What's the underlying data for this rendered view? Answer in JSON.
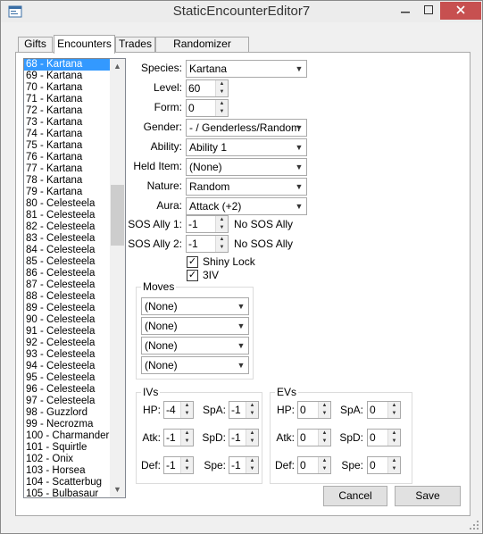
{
  "window": {
    "title": "StaticEncounterEditor7"
  },
  "tabs": [
    {
      "label": "Gifts"
    },
    {
      "label": "Encounters"
    },
    {
      "label": "Trades"
    },
    {
      "label": "Randomizer Options"
    }
  ],
  "encounter_list": {
    "selected_index": 0,
    "items": [
      "68 - Kartana",
      "69 - Kartana",
      "70 - Kartana",
      "71 - Kartana",
      "72 - Kartana",
      "73 - Kartana",
      "74 - Kartana",
      "75 - Kartana",
      "76 - Kartana",
      "77 - Kartana",
      "78 - Kartana",
      "79 - Kartana",
      "80 - Celesteela",
      "81 - Celesteela",
      "82 - Celesteela",
      "83 - Celesteela",
      "84 - Celesteela",
      "85 - Celesteela",
      "86 - Celesteela",
      "87 - Celesteela",
      "88 - Celesteela",
      "89 - Celesteela",
      "90 - Celesteela",
      "91 - Celesteela",
      "92 - Celesteela",
      "93 - Celesteela",
      "94 - Celesteela",
      "95 - Celesteela",
      "96 - Celesteela",
      "97 - Celesteela",
      "98 - Guzzlord",
      "99 - Necrozma",
      "100 - Charmander",
      "101 - Squirtle",
      "102 - Onix",
      "103 - Horsea",
      "104 - Scatterbug",
      "105 - Bulbasaur"
    ]
  },
  "fields": {
    "species": {
      "label": "Species:",
      "value": "Kartana"
    },
    "level": {
      "label": "Level:",
      "value": "60"
    },
    "form": {
      "label": "Form:",
      "value": "0"
    },
    "gender": {
      "label": "Gender:",
      "value": "- / Genderless/Random"
    },
    "ability": {
      "label": "Ability:",
      "value": "Ability 1"
    },
    "held_item": {
      "label": "Held Item:",
      "value": "(None)"
    },
    "nature": {
      "label": "Nature:",
      "value": "Random"
    },
    "aura": {
      "label": "Aura:",
      "value": "Attack (+2)"
    },
    "sos_ally_1": {
      "label": "SOS Ally 1:",
      "value": "-1",
      "status": "No SOS Ally"
    },
    "sos_ally_2": {
      "label": "SOS Ally 2:",
      "value": "-1",
      "status": "No SOS Ally"
    }
  },
  "checkboxes": {
    "shiny_lock": {
      "label": "Shiny Lock",
      "checked": true,
      "mark": "✓"
    },
    "three_iv": {
      "label": "3IV",
      "checked": true,
      "mark": "✓"
    }
  },
  "moves": {
    "title": "Moves",
    "items": [
      "(None)",
      "(None)",
      "(None)",
      "(None)"
    ]
  },
  "ivs": {
    "title": "IVs",
    "hp": {
      "label": "HP:",
      "value": "-4"
    },
    "atk": {
      "label": "Atk:",
      "value": "-1"
    },
    "def": {
      "label": "Def:",
      "value": "-1"
    },
    "spa": {
      "label": "SpA:",
      "value": "-1"
    },
    "spd": {
      "label": "SpD:",
      "value": "-1"
    },
    "spe": {
      "label": "Spe:",
      "value": "-1"
    }
  },
  "evs": {
    "title": "EVs",
    "hp": {
      "label": "HP:",
      "value": "0"
    },
    "atk": {
      "label": "Atk:",
      "value": "0"
    },
    "def": {
      "label": "Def:",
      "value": "0"
    },
    "spa": {
      "label": "SpA:",
      "value": "0"
    },
    "spd": {
      "label": "SpD:",
      "value": "0"
    },
    "spe": {
      "label": "Spe:",
      "value": "0"
    }
  },
  "buttons": {
    "cancel": "Cancel",
    "save": "Save"
  },
  "icons": {
    "app": "app-icon",
    "minimize": "minimize-icon",
    "maximize": "maximize-icon",
    "close": "close-icon",
    "dropdown": "chevron-down-icon",
    "spin_up": "spin-up-icon",
    "spin_down": "spin-down-icon"
  },
  "colors": {
    "selection": "#3399ff",
    "close_button": "#c75050",
    "window_bg": "#f0f0f0"
  }
}
